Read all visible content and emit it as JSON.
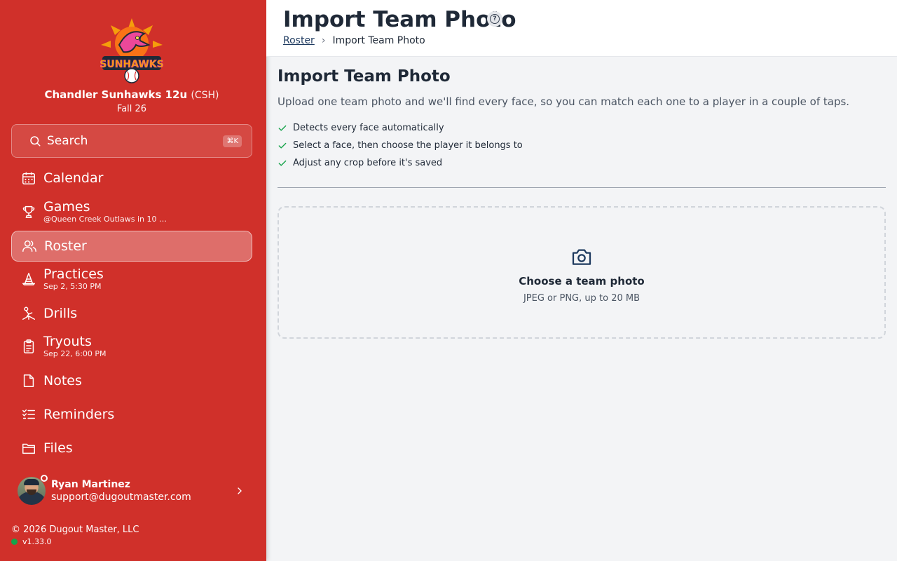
{
  "colors": {
    "sidebar": "#d0302a",
    "accent_link": "#1e3a5f",
    "check": "#16a34a",
    "online": "#16a34a"
  },
  "team": {
    "name": "Chandler Sunhawks 12u",
    "abbr": "(CSH)",
    "season": "Fall 26",
    "logo_icon": "sunhawks-logo"
  },
  "search": {
    "label": "Search",
    "shortcut": "⌘K"
  },
  "nav": [
    {
      "label": "Calendar",
      "sub": "",
      "icon": "calendar-icon",
      "active": false
    },
    {
      "label": "Games",
      "sub": "@Queen Creek Outlaws in 10 …",
      "icon": "trophy-icon",
      "active": false
    },
    {
      "label": "Roster",
      "sub": "",
      "icon": "users-icon",
      "active": true
    },
    {
      "label": "Practices",
      "sub": "Sep 2, 5:30 PM",
      "icon": "cone-icon",
      "active": false
    },
    {
      "label": "Drills",
      "sub": "",
      "icon": "drill-icon",
      "active": false
    },
    {
      "label": "Tryouts",
      "sub": "Sep 22, 6:00 PM",
      "icon": "clipboard-icon",
      "active": false
    },
    {
      "label": "Notes",
      "sub": "",
      "icon": "note-icon",
      "active": false
    },
    {
      "label": "Reminders",
      "sub": "",
      "icon": "checklist-icon",
      "active": false
    },
    {
      "label": "Files",
      "sub": "",
      "icon": "folder-icon",
      "active": false
    }
  ],
  "user": {
    "name": "Ryan Martinez",
    "email": "support@dugoutmaster.com"
  },
  "footer": {
    "copyright": "© 2026 Dugout Master, LLC",
    "version": "v1.33.0"
  },
  "header": {
    "title": "Import Team Photo",
    "breadcrumb": {
      "parent": "Roster",
      "separator": "›",
      "current": "Import Team Photo"
    }
  },
  "main": {
    "heading": "Import Team Photo",
    "description": "Upload one team photo and we'll find every face, so you can match each one to a player in a couple of taps.",
    "features": [
      "Detects every face automatically",
      "Select a face, then choose the player it belongs to",
      "Adjust any crop before it's saved"
    ],
    "dropzone": {
      "title": "Choose a team photo",
      "subtitle": "JPEG or PNG, up to 20 MB",
      "icon": "camera-icon"
    }
  }
}
